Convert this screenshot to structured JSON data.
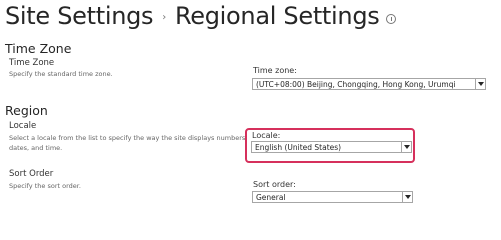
{
  "header": {
    "site_settings": "Site Settings",
    "separator": "›",
    "page_name": "Regional Settings"
  },
  "time_zone": {
    "heading": "Time Zone",
    "title": "Time Zone",
    "description": "Specify the standard time zone.",
    "field_label": "Time zone:",
    "value": "(UTC+08:00) Beijing, Chongqing, Hong Kong, Urumqi"
  },
  "region": {
    "heading": "Region",
    "locale": {
      "title": "Locale",
      "description_line1": "Select a locale from the list to specify the way the site displays numbers,",
      "description_line2": "dates, and time.",
      "field_label": "Locale:",
      "value": "English (United States)"
    },
    "sort_order": {
      "title": "Sort Order",
      "description": "Specify the sort order.",
      "field_label": "Sort order:",
      "value": "General"
    }
  },
  "colors": {
    "highlight": "#d6305c"
  }
}
